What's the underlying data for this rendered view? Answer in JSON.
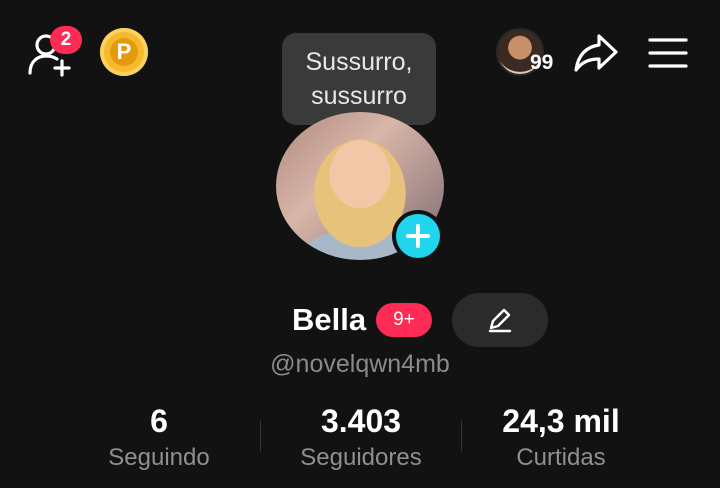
{
  "header": {
    "friend_requests_badge": "2",
    "coin_label": "P",
    "visitor_count": "99"
  },
  "tooltip": {
    "line1": "Sussurro,",
    "line2": "sussurro"
  },
  "profile": {
    "name": "Bella",
    "name_badge": "9+",
    "handle": "@novelqwn4mb"
  },
  "stats": [
    {
      "value": "6",
      "label": "Seguindo"
    },
    {
      "value": "3.403",
      "label": "Seguidores"
    },
    {
      "value": "24,3 mil",
      "label": "Curtidas"
    }
  ],
  "icons": {
    "add_friends": "add-user-icon",
    "coin": "coin-icon",
    "share": "share-icon",
    "menu": "hamburger-menu-icon",
    "edit": "pencil-icon",
    "avatar_add": "plus-icon"
  },
  "colors": {
    "background": "#121212",
    "badge": "#fe2c55",
    "accent": "#20d5ec",
    "coin": "#f4b92c"
  }
}
